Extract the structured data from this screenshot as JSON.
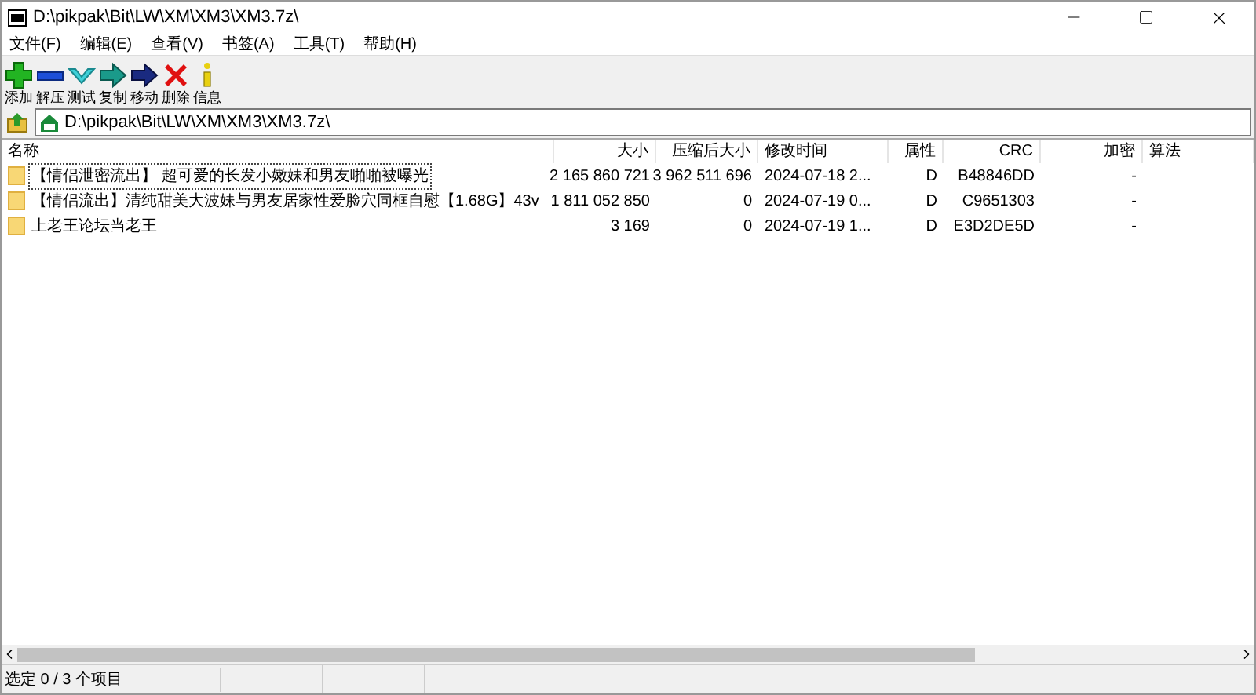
{
  "window": {
    "title": "D:\\pikpak\\Bit\\LW\\XM\\XM3\\XM3.7z\\"
  },
  "menu": [
    "文件(F)",
    "编辑(E)",
    "查看(V)",
    "书签(A)",
    "工具(T)",
    "帮助(H)"
  ],
  "toolbar": [
    {
      "kind": "add",
      "label": "添加"
    },
    {
      "kind": "extract",
      "label": "解压"
    },
    {
      "kind": "test",
      "label": "测试"
    },
    {
      "kind": "copy",
      "label": "复制"
    },
    {
      "kind": "move",
      "label": "移动"
    },
    {
      "kind": "delete",
      "label": "删除"
    },
    {
      "kind": "info",
      "label": "信息"
    }
  ],
  "address": {
    "value": "D:\\pikpak\\Bit\\LW\\XM\\XM3\\XM3.7z\\"
  },
  "table": {
    "columns": [
      "名称",
      "大小",
      "压缩后大小",
      "修改时间",
      "属性",
      "CRC",
      "加密",
      "算法"
    ],
    "rows": [
      {
        "focused": true,
        "cells": [
          "【情侣泄密流出】 超可爱的长发小嫩妹和男友啪啪被曝光",
          "2 165 860 721",
          "3 962 511 696",
          "2024-07-18 2...",
          "D",
          "B48846DD",
          "-"
        ]
      },
      {
        "focused": false,
        "cells": [
          "【情侣流出】清纯甜美大波妹与男友居家性爱脸穴同框自慰【1.68G】43v",
          "1 811 052 850",
          "0",
          "2024-07-19 0...",
          "D",
          "C9651303",
          "-"
        ]
      },
      {
        "focused": false,
        "cells": [
          "上老王论坛当老王",
          "3 169",
          "0",
          "2024-07-19 1...",
          "D",
          "E3D2DE5D",
          "-"
        ]
      }
    ]
  },
  "status_bar": [
    "选定 0 / 3 个项目"
  ]
}
